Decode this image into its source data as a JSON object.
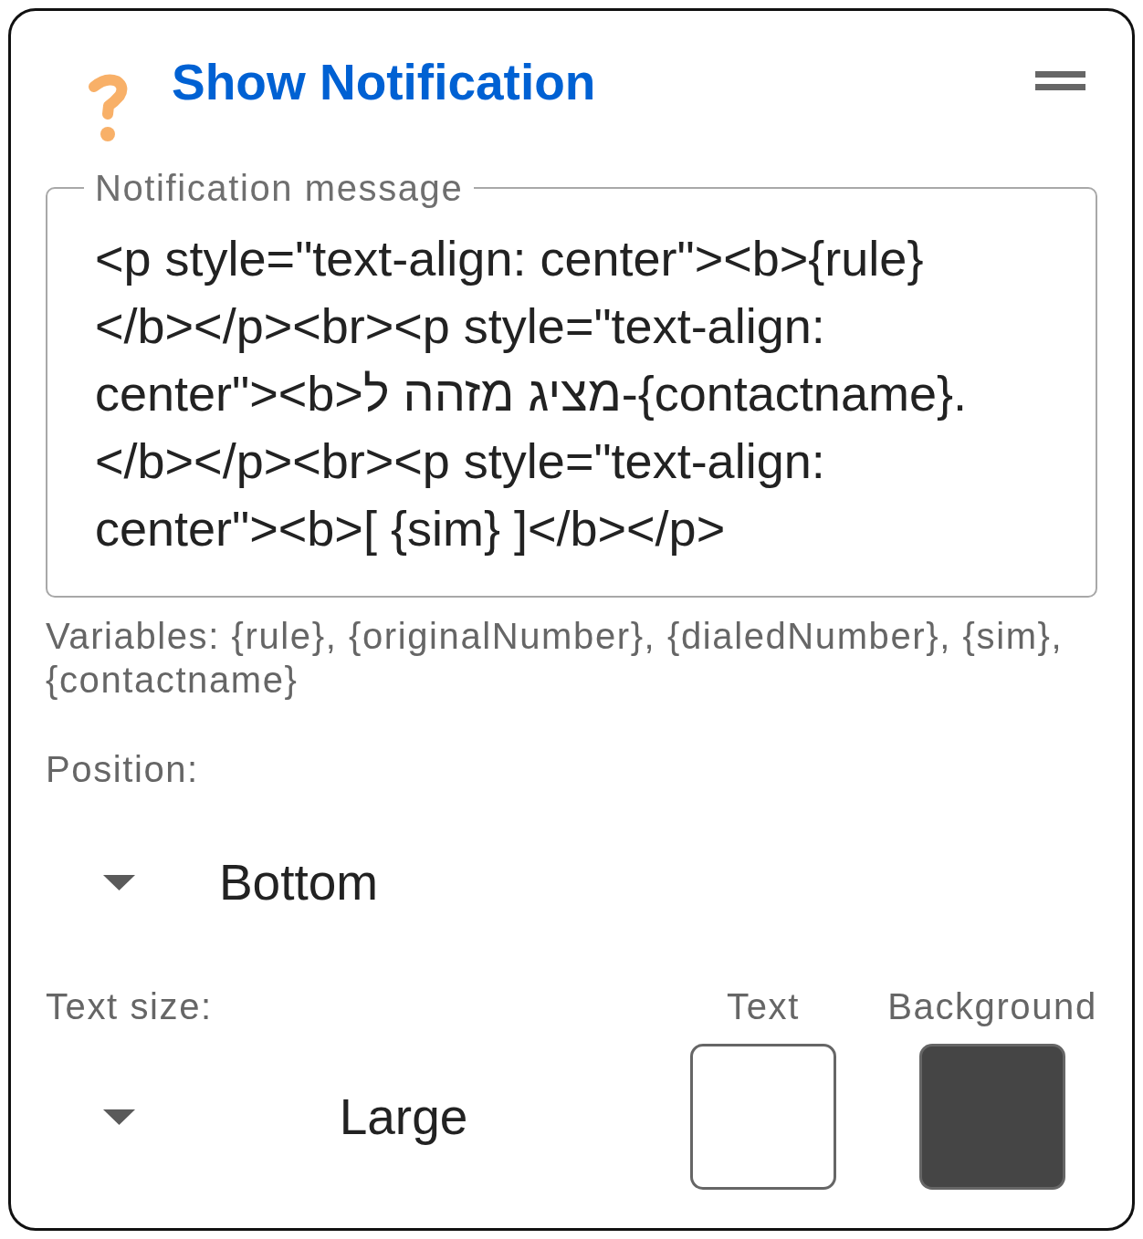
{
  "header": {
    "title": "Show Notification"
  },
  "message": {
    "label": "Notification message",
    "value": "<p style=\"text-align: center\"><b>{rule}</b></p><br><p style=\"text-align: center\"><b>מציג מזהה ל-{contactname}.</b></p><br><p style=\"text-align: center\"><b>[ {sim} ]</b></p>"
  },
  "variables_hint": "Variables: {rule}, {originalNumber}, {dialedNumber}, {sim}, {contactname}",
  "position": {
    "label": "Position:",
    "value": "Bottom"
  },
  "text_size": {
    "label": "Text size:",
    "value": "Large"
  },
  "text_color": {
    "label": "Text",
    "color": "#ffffff"
  },
  "background_color": {
    "label": "Background",
    "color": "#454545"
  }
}
